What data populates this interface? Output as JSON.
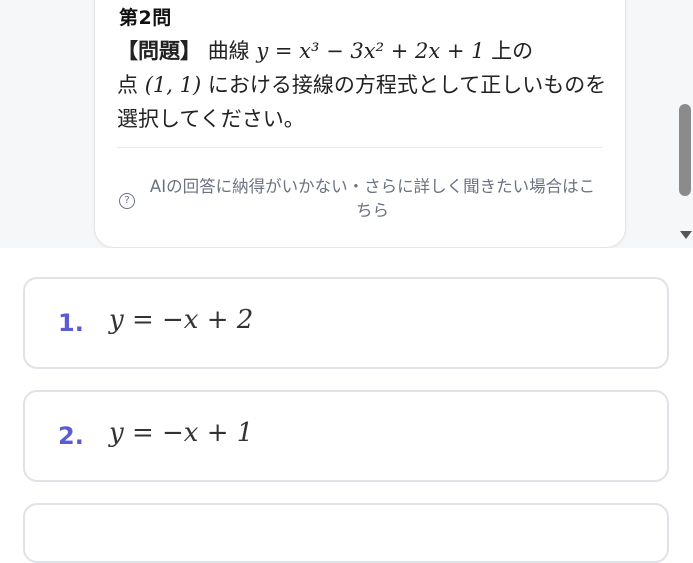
{
  "question": {
    "number": "第2問",
    "tag": "【問題】",
    "lead": "曲線",
    "curve": "y = x³ − 3x² + 2x + 1",
    "mid": "上の",
    "point_prefix": "点",
    "point": "(1, 1)",
    "rest": "における接線の方程式として正しいものを選択してください。"
  },
  "help": {
    "icon": "question-circle-icon",
    "text": "AIの回答に納得がいかない・さらに詳しく聞きたい場合はこちら"
  },
  "choices": [
    {
      "number": "1.",
      "answer": "y = −x + 2"
    },
    {
      "number": "2.",
      "answer": "y = −x + 1"
    },
    {
      "number": "",
      "answer": ""
    }
  ],
  "colors": {
    "accent": "#5b5bd6",
    "muted": "#6b7280",
    "border": "#dfe3e8"
  }
}
